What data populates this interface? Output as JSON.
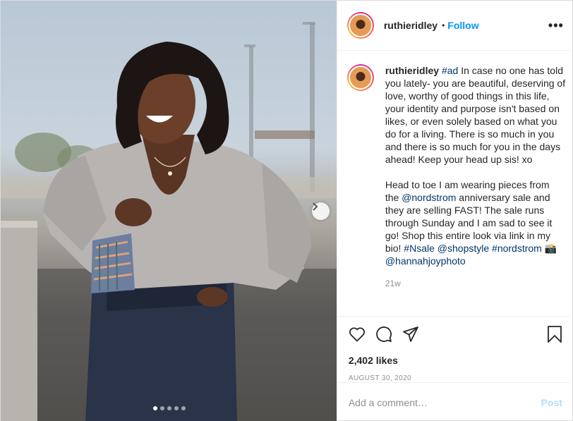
{
  "photo": {
    "alt": "Woman in grey sweater and jeans laughing outdoors",
    "carousel_dots": 5,
    "active_dot": 0
  },
  "header": {
    "username": "ruthieridley",
    "separator": "•",
    "follow_label": "Follow",
    "more_icon": "more-options-icon"
  },
  "caption": {
    "username": "ruthieridley",
    "hashtag_ad": "#ad",
    "text_1": " In case no one has told you lately- you are beautiful, deserving of love, worthy of good things in this life, your identity and purpose isn't based on likes, or even solely based on what you do for a living. There is so much in you and there is so much for you in the days ahead! Keep your head up sis! xo",
    "text_2a": "Head to toe I am wearing pieces from the ",
    "mention_nordstrom": "@nordstrom",
    "text_2b": " anniversary sale and they are selling FAST! The sale runs through Sunday and I am sad to see it go! Shop this entire look via link in my bio! ",
    "hashtag_nsale": "#Nsale",
    "mention_shopstyle": "@shopstyle",
    "hashtag_nordstrom": "#nordstrom",
    "camera_emoji": "📸",
    "mention_photo": "@hannahjoyphoto",
    "time_ago": "21w"
  },
  "actions": {
    "likes": "2,402 likes",
    "date": "AUGUST 30, 2020"
  },
  "comment": {
    "placeholder": "Add a comment…",
    "post_label": "Post"
  },
  "colors": {
    "link": "#00376b",
    "follow": "#0095f6",
    "muted": "#8e8e8e",
    "post_disabled": "#b2dffc"
  }
}
